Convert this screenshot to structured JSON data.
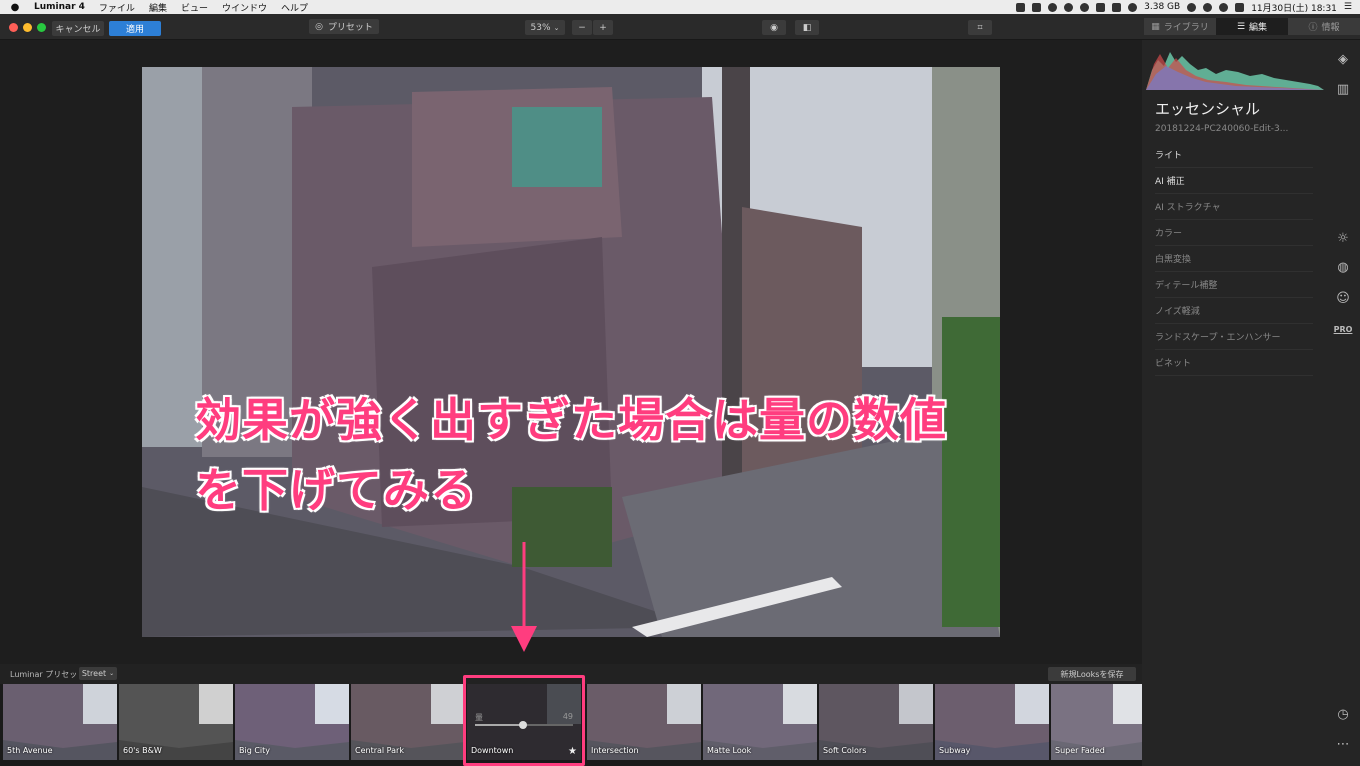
{
  "menubar": {
    "app_name": "Luminar 4",
    "items": [
      "ファイル",
      "編集",
      "ビュー",
      "ウインドウ",
      "ヘルプ"
    ],
    "memory": "3.38 GB",
    "datetime": "11月30日(土) 18:31"
  },
  "toolbar": {
    "cancel_label": "キャンセル",
    "apply_label": "適用",
    "preset_label": "プリセット",
    "zoom": "53%",
    "zoom_minus": "−",
    "zoom_plus": "+",
    "tabs": [
      {
        "label": "ライブラリ",
        "active": false
      },
      {
        "label": "編集",
        "active": true
      },
      {
        "label": "情報",
        "active": false
      }
    ]
  },
  "overlay": {
    "line1": "効果が強く出すぎた場合は量の数値",
    "line2": "を下げてみる",
    "color": "#ff3d7f"
  },
  "panel": {
    "title": "エッセンシャル",
    "filename": "20181224-PC240060-Edit-3...",
    "tools": [
      {
        "label": "ライト",
        "bright": true
      },
      {
        "label": "AI 補正",
        "bright": true
      },
      {
        "label": "AI ストラクチャ",
        "bright": false
      },
      {
        "label": "カラー",
        "bright": false
      },
      {
        "label": "白黒変換",
        "bright": false
      },
      {
        "label": "ディテール補整",
        "bright": false
      },
      {
        "label": "ノイズ軽減",
        "bright": false
      },
      {
        "label": "ランドスケープ・エンハンサー",
        "bright": false
      },
      {
        "label": "ビネット",
        "bright": false
      }
    ],
    "pro_label": "PRO"
  },
  "presets": {
    "bar_label": "Luminar プリセット",
    "category": "Street",
    "save_label": "新規Looksを保存",
    "amount_label": "量",
    "amount_value": "49",
    "amount_fraction": 0.49,
    "items": [
      "5th Avenue",
      "60's B&W",
      "Big City",
      "Central Park",
      "Downtown",
      "Intersection",
      "Matte Look",
      "Soft Colors",
      "Subway",
      "Super Faded"
    ],
    "selected": "Downtown"
  }
}
